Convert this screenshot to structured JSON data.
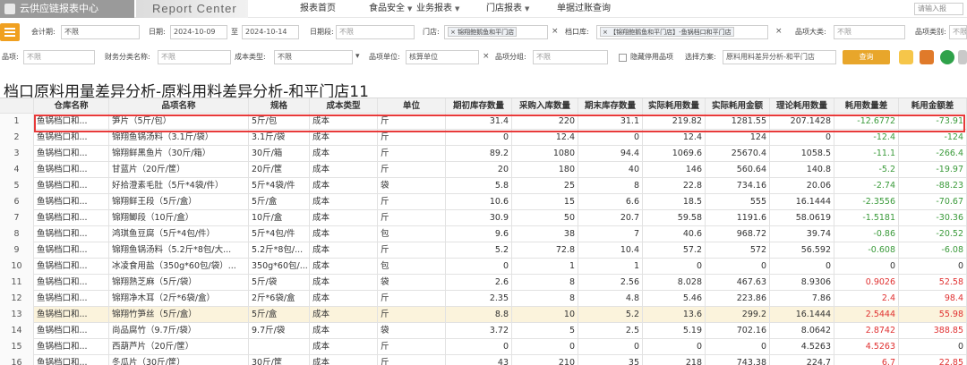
{
  "header": {
    "brand": "云供应链报表中心",
    "report_center": "Report Center",
    "nav": [
      {
        "label": "报表首页",
        "dropdown": false
      },
      {
        "label": "食品安全",
        "dropdown": true
      },
      {
        "label": "业务报表",
        "dropdown": true
      },
      {
        "label": "门店报表",
        "dropdown": true
      },
      {
        "label": "单据过账查询",
        "dropdown": false
      }
    ],
    "login_placeholder": "请输入报"
  },
  "filters": {
    "row1": {
      "accounting_period_label": "会计期:",
      "accounting_period_value": "不限",
      "date_label": "日期:",
      "date_from": "2024-10-09",
      "date_sep": "至",
      "date_to": "2024-10-14",
      "date_range_label": "日期段:",
      "date_range_value": "不限",
      "store_label": "门店:",
      "store_tag": "锦翔鲍鹅鱼和平门店",
      "stall_label": "档口库:",
      "stall_tag": "【锦翔鲍鹅鱼和平门店】-鱼锅档口和平门店",
      "category_big_label": "品项大类:",
      "category_big_value": "不限",
      "category_label": "品项类别:",
      "category_value": "不限"
    },
    "row2": {
      "item_label": "品项:",
      "item_value": "不限",
      "finance_class_label": "财务分类名称:",
      "finance_class_value": "不限",
      "cost_type_label": "成本类型:",
      "cost_type_value": "不限",
      "item_unit_label": "品项单位:",
      "item_unit_value": "核算单位",
      "item_group_label": "品项分组:",
      "item_group_value": "不限",
      "hide_disabled_label": "隐藏停用品项",
      "scheme_label": "选择方案:",
      "scheme_value": "原料用料差异分析-和平门店",
      "query_label": "查询"
    }
  },
  "page_title": "档口原料用量差异分析-原料用料差异分析-和平门店11",
  "table": {
    "headers": [
      "",
      "仓库名称",
      "品项名称",
      "规格",
      "成本类型",
      "单位",
      "期初库存数量",
      "采购入库数量",
      "期末库存数量",
      "实际耗用数量",
      "实际耗用金额",
      "理论耗用数量",
      "耗用数量差",
      "耗用金额差"
    ],
    "rows": [
      [
        "1",
        "鱼锅档口和...",
        "笋片（5斤/包）",
        "5斤/包",
        "成本",
        "斤",
        "31.4",
        "220",
        "31.1",
        "219.82",
        "1281.55",
        "207.1428",
        "-12.6772",
        "-73.91"
      ],
      [
        "2",
        "鱼锅档口和...",
        "锦翔鱼锅汤料（3.1斤/袋）",
        "3.1斤/袋",
        "成本",
        "斤",
        "0",
        "12.4",
        "0",
        "12.4",
        "124",
        "0",
        "-12.4",
        "-124"
      ],
      [
        "3",
        "鱼锅档口和...",
        "锦翔鲜黑鱼片（30斤/箱）",
        "30斤/箱",
        "成本",
        "斤",
        "89.2",
        "1080",
        "94.4",
        "1069.6",
        "25670.4",
        "1058.5",
        "-11.1",
        "-266.4"
      ],
      [
        "4",
        "鱼锅档口和...",
        "甘蓝片（20斤/筐）",
        "20斤/筐",
        "成本",
        "斤",
        "20",
        "180",
        "40",
        "146",
        "560.64",
        "140.8",
        "-5.2",
        "-19.97"
      ],
      [
        "5",
        "鱼锅档口和...",
        "好拾澄素毛肚（5斤*4袋/件）",
        "5斤*4袋/件",
        "成本",
        "袋",
        "5.8",
        "25",
        "8",
        "22.8",
        "734.16",
        "20.06",
        "-2.74",
        "-88.23"
      ],
      [
        "6",
        "鱼锅档口和...",
        "锦翔鲜王段（5斤/盒）",
        "5斤/盒",
        "成本",
        "斤",
        "10.6",
        "15",
        "6.6",
        "18.5",
        "555",
        "16.1444",
        "-2.3556",
        "-70.67"
      ],
      [
        "7",
        "鱼锅档口和...",
        "锦翔鲫段（10斤/盒）",
        "10斤/盒",
        "成本",
        "斤",
        "30.9",
        "50",
        "20.7",
        "59.58",
        "1191.6",
        "58.0619",
        "-1.5181",
        "-30.36"
      ],
      [
        "8",
        "鱼锅档口和...",
        "鸿琪鱼豆腐（5斤*4包/件）",
        "5斤*4包/件",
        "成本",
        "包",
        "9.6",
        "38",
        "7",
        "40.6",
        "968.72",
        "39.74",
        "-0.86",
        "-20.52"
      ],
      [
        "9",
        "鱼锅档口和...",
        "锦翔鱼锅汤料（5.2斤*8包/大...",
        "5.2斤*8包/...",
        "成本",
        "斤",
        "5.2",
        "72.8",
        "10.4",
        "57.2",
        "572",
        "56.592",
        "-0.608",
        "-6.08"
      ],
      [
        "10",
        "鱼锅档口和...",
        "冰凌食用盐（350g*60包/袋）...",
        "350g*60包/...",
        "成本",
        "包",
        "0",
        "1",
        "1",
        "0",
        "0",
        "0",
        "0",
        "0"
      ],
      [
        "11",
        "鱼锅档口和...",
        "锦翔熟芝麻（5斤/袋）",
        "5斤/袋",
        "成本",
        "袋",
        "2.6",
        "8",
        "2.56",
        "8.028",
        "467.63",
        "8.9306",
        "0.9026",
        "52.58"
      ],
      [
        "12",
        "鱼锅档口和...",
        "锦翔净木耳（2斤*6袋/盒）",
        "2斤*6袋/盒",
        "成本",
        "斤",
        "2.35",
        "8",
        "4.8",
        "5.46",
        "223.86",
        "7.86",
        "2.4",
        "98.4"
      ],
      [
        "13",
        "鱼锅档口和...",
        "锦翔竹笋丝（5斤/盒）",
        "5斤/盒",
        "成本",
        "斤",
        "8.8",
        "10",
        "5.2",
        "13.6",
        "299.2",
        "16.1444",
        "2.5444",
        "55.98"
      ],
      [
        "14",
        "鱼锅档口和...",
        "尚品腐竹（9.7斤/袋）",
        "9.7斤/袋",
        "成本",
        "袋",
        "3.72",
        "5",
        "2.5",
        "5.19",
        "702.16",
        "8.0642",
        "2.8742",
        "388.85"
      ],
      [
        "15",
        "鱼锅档口和...",
        "西葫芦片（20斤/筐）",
        "",
        "成本",
        "斤",
        "0",
        "0",
        "0",
        "0",
        "0",
        "4.5263",
        "4.5263",
        "0"
      ],
      [
        "16",
        "鱼锅档口和...",
        "冬瓜片（30斤/筐）",
        "30斤/筐",
        "成本",
        "斤",
        "43",
        "210",
        "35",
        "218",
        "743.38",
        "224.7",
        "6.7",
        "22.85"
      ]
    ]
  },
  "colors": {
    "accent": "#e8a62b",
    "highlight_row": "#fbf3dc",
    "negative": "#3a9a3a",
    "positive": "#e03030",
    "selection": "#e83a3a"
  }
}
